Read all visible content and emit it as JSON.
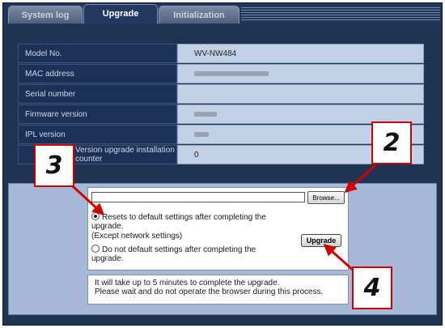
{
  "tabs": [
    {
      "label": "System log",
      "active": false
    },
    {
      "label": "Upgrade",
      "active": true
    },
    {
      "label": "Initialization",
      "active": false
    }
  ],
  "info_rows": [
    {
      "label": "Model No.",
      "value": "WV-NW484"
    },
    {
      "label": "MAC address",
      "value": ""
    },
    {
      "label": "Serial number",
      "value": ""
    },
    {
      "label": "Firmware version",
      "value": ""
    },
    {
      "label": "IPL version",
      "value": ""
    },
    {
      "label": "Version upgrade installation counter",
      "value": "0"
    }
  ],
  "upgrade_form": {
    "file_value": "",
    "browse_label": "Browse...",
    "option_reset_line1": "Resets to default settings after completing the",
    "option_reset_line2": "upgrade.",
    "option_reset_line3": "(Except network settings)",
    "option_reset_selected": true,
    "option_keep_line1": "Do not default settings after completing the",
    "option_keep_line2": "upgrade.",
    "option_keep_selected": false,
    "upgrade_label": "Upgrade",
    "notice_line1": "It will take up to 5 minutes to complete the upgrade.",
    "notice_line2": "Please wait and do not operate the browser during this process."
  },
  "callouts": {
    "c2": "2",
    "c3": "3",
    "c4": "4",
    "color": "#d00000"
  }
}
